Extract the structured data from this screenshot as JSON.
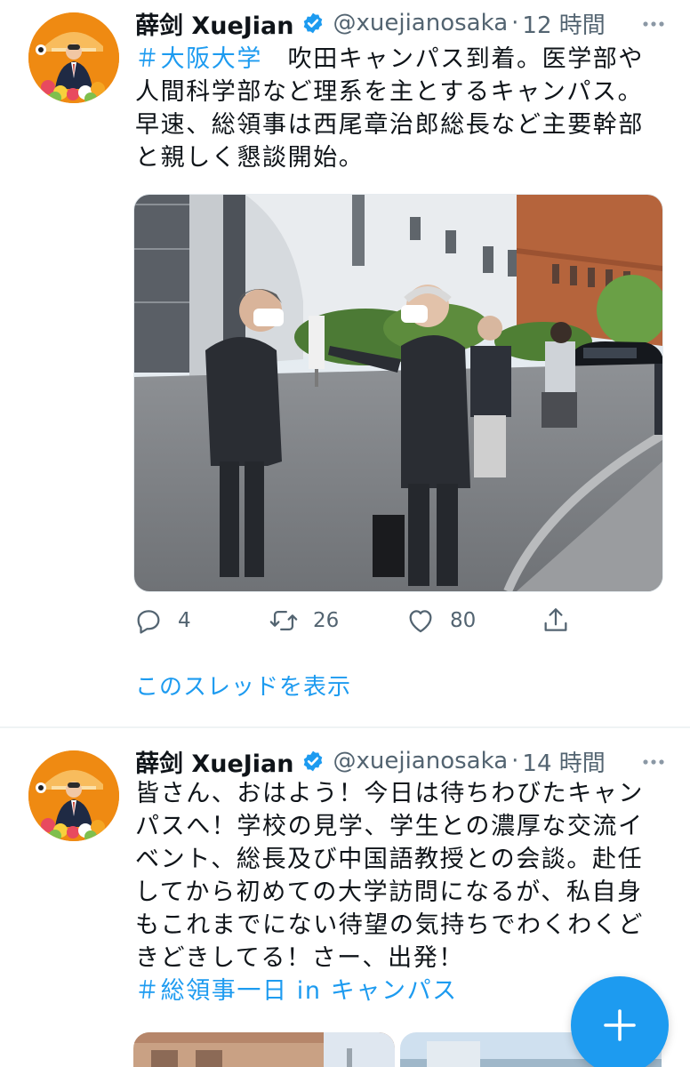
{
  "tweets": [
    {
      "display_name": "薛剑 XueJian",
      "handle": "@xuejianosaka",
      "separator": "·",
      "time": "12 時間",
      "text_hashtag": "＃大阪大学",
      "text_body": "　吹田キャンパス到着。医学部や人間科学部など理系を主とするキャンパス。早速、総領事は西尾章治郎総長など主要幹部と親しく懇談開始。",
      "replies": "4",
      "retweets": "26",
      "likes": "80",
      "thread_link": "このスレッドを表示"
    },
    {
      "display_name": "薛剑 XueJian",
      "handle": "@xuejianosaka",
      "separator": "·",
      "time": "14 時間",
      "text_body": "皆さん、おはよう！今日は待ちわびたキャンパスへ！学校の見学、学生との濃厚な交流イベント、総長及び中国語教授との会談。赴任してから初めての大学訪問になるが、私自身もこれまでにない待望の気持ちでわくわくどきどきしてる！さー、出発！",
      "text_hashtag": "＃総領事一日 in キャンパス"
    }
  ],
  "icons": {
    "verified": "verified-badge-icon",
    "more": "more-icon",
    "reply": "reply-icon",
    "retweet": "retweet-icon",
    "like": "heart-icon",
    "share": "share-icon",
    "compose": "plus-icon"
  },
  "colors": {
    "accent": "#1d9bf0",
    "text": "#0f1419",
    "secondary": "#536471",
    "avatar_bg": "#ef8a12"
  }
}
